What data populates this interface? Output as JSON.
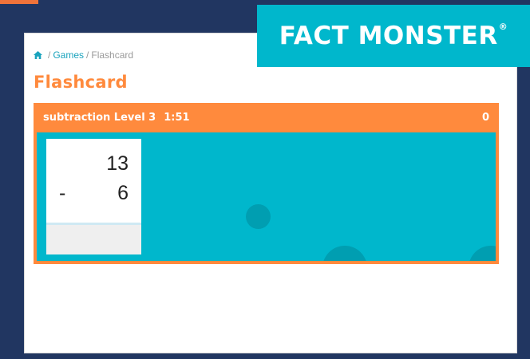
{
  "logo": {
    "text": "FACT MONSTER",
    "reg": "®"
  },
  "breadcrumb": {
    "home_icon": "home-icon",
    "games_label": "Games",
    "separator": "/",
    "current_label": "Flashcard"
  },
  "page": {
    "title": "Flashcard"
  },
  "game": {
    "operation": "subtraction",
    "level": "Level 3",
    "timer": "1:51",
    "score": "0",
    "card": {
      "top": "13",
      "operator": "-",
      "bottom": "6",
      "answer": ""
    }
  },
  "colors": {
    "background": "#213661",
    "accent_orange": "#ff8a3d",
    "accent_teal": "#00b7cc",
    "link": "#1aa3bd"
  }
}
